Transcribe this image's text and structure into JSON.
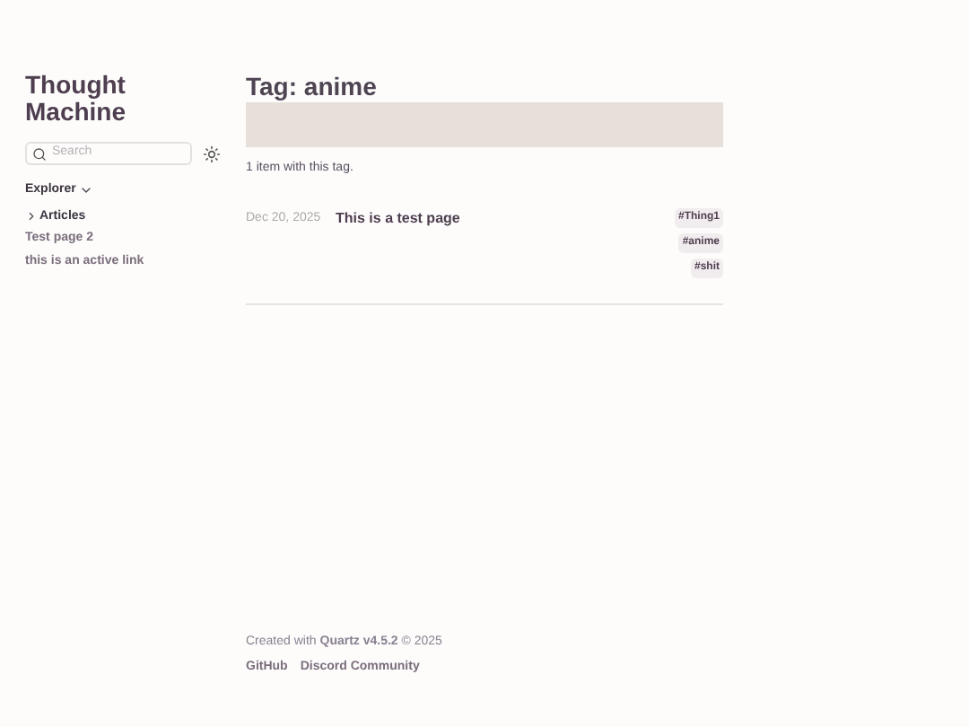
{
  "site_title": "Thought Machine",
  "search": {
    "placeholder": "Search"
  },
  "explorer": {
    "title": "Explorer",
    "expanded": true,
    "items": [
      {
        "label": "Articles",
        "kind": "folder",
        "expanded": false
      },
      {
        "label": "Test page 2",
        "kind": "page"
      },
      {
        "label": "this is an active link",
        "kind": "page"
      }
    ]
  },
  "page": {
    "title": "Tag: anime",
    "count_text": "1 item with this tag.",
    "items": [
      {
        "date": "Dec 20, 2025",
        "title": "This is a test page",
        "tags": [
          "#Thing1",
          "#anime",
          "#shit"
        ]
      }
    ]
  },
  "footer": {
    "credit": "Created with **Quartz v4.5.2** © 2025",
    "links": [
      "GitHub",
      "Discord Community"
    ]
  }
}
